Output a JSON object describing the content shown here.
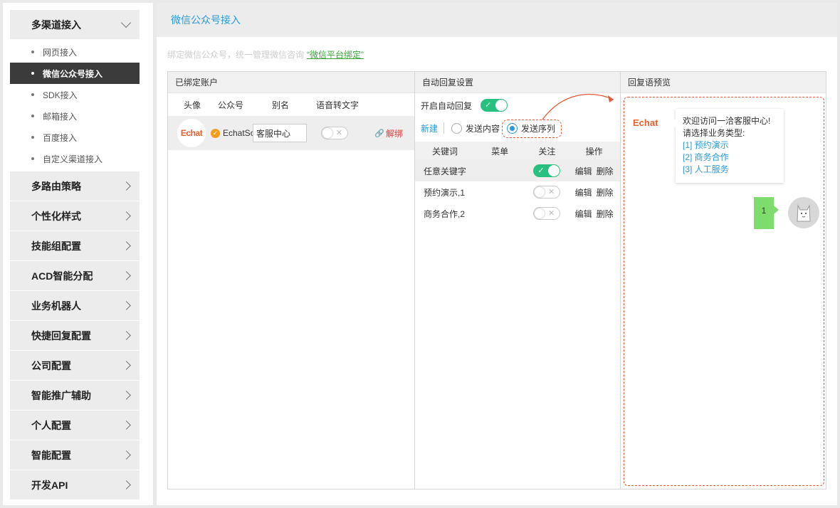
{
  "sidebar": {
    "groups": [
      {
        "label": "多渠道接入"
      },
      {
        "label": "多路由策略"
      },
      {
        "label": "个性化样式"
      },
      {
        "label": "技能组配置"
      },
      {
        "label": "ACD智能分配"
      },
      {
        "label": "业务机器人"
      },
      {
        "label": "快捷回复配置"
      },
      {
        "label": "公司配置"
      },
      {
        "label": "智能推广辅助"
      },
      {
        "label": "个人配置"
      },
      {
        "label": "智能配置"
      },
      {
        "label": "开发API"
      }
    ],
    "sub_items": [
      {
        "label": "网页接入"
      },
      {
        "label": "微信公众号接入"
      },
      {
        "label": "SDK接入"
      },
      {
        "label": "邮箱接入"
      },
      {
        "label": "百度接入"
      },
      {
        "label": "自定义渠道接入"
      }
    ]
  },
  "main": {
    "title": "微信公众号接入",
    "hint": "绑定微信公众号，统一管理微信咨询",
    "bind_link": "“微信平台绑定”"
  },
  "accounts": {
    "title": "已绑定账户",
    "columns": [
      "头像",
      "公众号",
      "别名",
      "语音转文字"
    ],
    "row": {
      "logo": "Echat",
      "name": "EchatSoft",
      "alias": "客服中心",
      "voice_to_text": false,
      "unbind": "解绑"
    }
  },
  "autoreply": {
    "title": "自动回复设置",
    "switch_label": "开启自动回复",
    "enabled": true,
    "new_label": "新建",
    "mode_content": "发送内容",
    "mode_sequence": "发送序列",
    "selected_mode": "发送序列",
    "columns": [
      "关键词",
      "菜单",
      "关注",
      "操作"
    ],
    "rows": [
      {
        "keyword": "任意关键字",
        "menu": "",
        "follow": true,
        "edit": "编辑",
        "delete": "删除"
      },
      {
        "keyword": "预约演示,1",
        "menu": "",
        "follow": false,
        "edit": "编辑",
        "delete": "删除"
      },
      {
        "keyword": "商务合作,2",
        "menu": "",
        "follow": false,
        "edit": "编辑",
        "delete": "删除"
      }
    ]
  },
  "preview": {
    "title": "回复语预览",
    "logo": "Echat",
    "greeting": "欢迎访问一洽客服中心!",
    "prompt": "请选择业务类型:",
    "options": [
      "[1] 预约演示",
      "[2] 商务合作",
      "[3] 人工服务"
    ],
    "user_reply": "1"
  },
  "colors": {
    "accent_blue": "#2b9ad6",
    "toggle_green": "#27c07f",
    "danger_red": "#e03c3c",
    "annotation_orange": "#e55a3a",
    "user_bubble": "#7edc6d"
  }
}
